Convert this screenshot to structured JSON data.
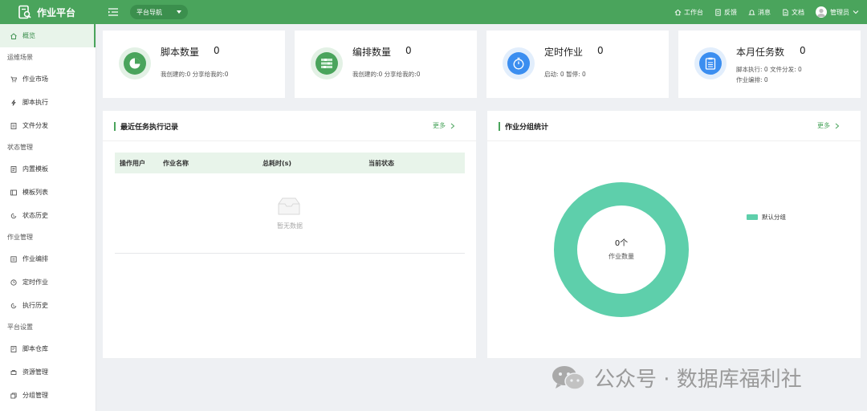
{
  "topbar": {
    "brand_title": "作业平台",
    "nav_select": "平台导航",
    "links": [
      "工作台",
      "反馈",
      "消息",
      "文档"
    ],
    "user": "管理员"
  },
  "sidebar": {
    "items": [
      {
        "label": "概览",
        "group": null,
        "active": true
      },
      {
        "label": "运维场景",
        "group": true
      },
      {
        "label": "作业市场"
      },
      {
        "label": "脚本执行"
      },
      {
        "label": "文件分发"
      },
      {
        "label": "状态管理",
        "group": true
      },
      {
        "label": "内置模板"
      },
      {
        "label": "模板列表"
      },
      {
        "label": "状态历史"
      },
      {
        "label": "作业管理",
        "group": true
      },
      {
        "label": "作业编排"
      },
      {
        "label": "定时作业"
      },
      {
        "label": "执行历史"
      },
      {
        "label": "平台设置",
        "group": true
      },
      {
        "label": "脚本仓库"
      },
      {
        "label": "资源管理"
      },
      {
        "label": "分组管理"
      }
    ]
  },
  "stats": [
    {
      "title": "脚本数量",
      "count": "0",
      "sub": "我创建的:0   分享给我的:0"
    },
    {
      "title": "编排数量",
      "count": "0",
      "sub": "我创建的:0   分享给我的:0"
    },
    {
      "title": "定时作业",
      "count": "0",
      "sub": "启动:  0    暂停:  0"
    },
    {
      "title": "本月任务数",
      "count": "0",
      "sub": "脚本执行:  0    文件分发:  0",
      "sub2": "作业编排:  0"
    }
  ],
  "records_panel": {
    "title": "最近任务执行记录",
    "more": "更多",
    "columns": [
      "操作用户",
      "作业名称",
      "总耗时(s)",
      "当前状态"
    ],
    "empty_text": "暂无数据"
  },
  "group_panel": {
    "title": "作业分组统计",
    "more": "更多",
    "center_value": "0个",
    "center_label": "作业数量",
    "legend": "默认分组"
  },
  "chart_data": {
    "type": "pie",
    "categories": [
      "默认分组"
    ],
    "values": [
      1
    ],
    "colors": [
      "#5ecfab"
    ]
  },
  "watermark": "公众号 · 数据库福利社",
  "colors": {
    "primary": "#4aa45c",
    "donut": "#5ecfab",
    "active_bg": "#e8f4ea"
  }
}
